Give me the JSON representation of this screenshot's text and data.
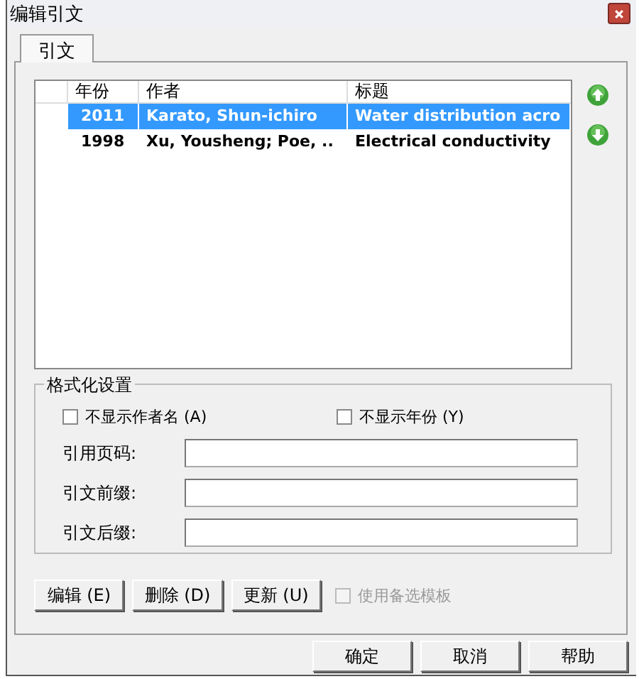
{
  "window": {
    "title": "编辑引文"
  },
  "tabs": [
    {
      "label": "引文",
      "selected": true
    }
  ],
  "table": {
    "columns": [
      "年份",
      "作者",
      "标题"
    ],
    "rows": [
      {
        "cells": [
          "2011",
          "Karato, Shun-ichiro",
          "Water distribution acro"
        ],
        "selected": true
      },
      {
        "cells": [
          "1998",
          "Xu, Yousheng; Poe, ..",
          "Electrical conductivity"
        ],
        "selected": false
      }
    ]
  },
  "format_settings": {
    "title": "格式化设置",
    "checkboxes": [
      {
        "label": "不显示作者名 (A)",
        "checked": false
      },
      {
        "label": "不显示年份 (Y)",
        "checked": false
      }
    ],
    "fields": [
      {
        "label": "引用页码:"
      },
      {
        "label": "引文前缀:"
      },
      {
        "label": "引文后缀:"
      }
    ]
  },
  "actions": [
    {
      "label": "编辑 (E)"
    },
    {
      "label": "删除 (D)"
    },
    {
      "label": "更新 (U)"
    }
  ],
  "alt_template": {
    "label": "使用备选模板",
    "checked": false,
    "disabled": true
  },
  "buttons": [
    "确定",
    "取消",
    "帮助"
  ]
}
